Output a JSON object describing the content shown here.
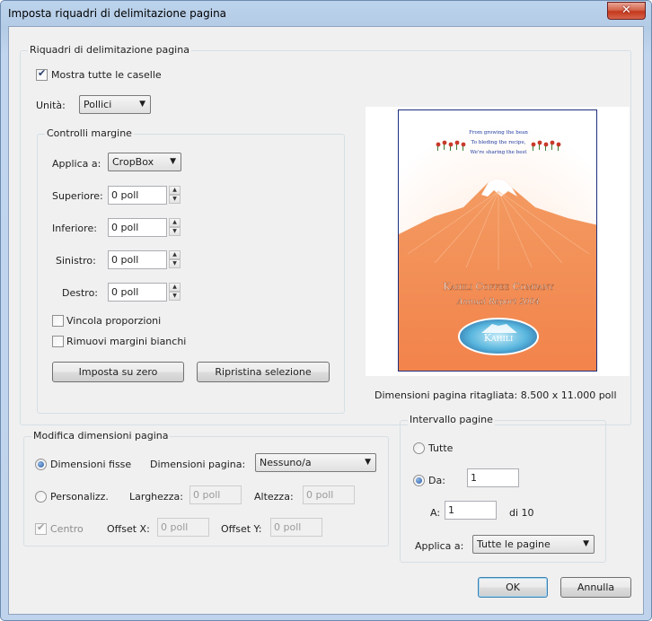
{
  "title": "Imposta riquadri di delimitazione pagina",
  "close_label": "✕",
  "boxes": {
    "title": "Riquadri di delimitazione pagina",
    "show_all": {
      "label": "Mostra tutte le caselle",
      "checked": true
    },
    "units_label": "Unità:",
    "units_value": "Pollici",
    "margins": {
      "title": "Controlli margine",
      "apply_label": "Applica a:",
      "apply_value": "CropBox",
      "top_label": "Superiore:",
      "top_value": "0 poll",
      "bottom_label": "Inferiore:",
      "bottom_value": "0 poll",
      "left_label": "Sinistro:",
      "left_value": "0 poll",
      "right_label": "Destro:",
      "right_value": "0 poll",
      "constrain_label": "Vincola proporzioni",
      "remove_white_label": "Rimuovi margini bianchi",
      "set_zero_label": "Imposta su zero",
      "revert_label": "Ripristina selezione"
    },
    "preview_caption": "Dimensioni pagina ritagliata: 8.500 x 11.000 poll",
    "page_text": {
      "line1": "From growing the bean",
      "line2": "To bleding the recipe,",
      "line3": "We're sharing the best",
      "company": "Kahili Coffee Company",
      "report": "Annual Report 2004",
      "logo": "Kahili"
    }
  },
  "resize": {
    "title": "Modifica dimensioni pagina",
    "fixed_label": "Dimensioni fisse",
    "page_size_label": "Dimensioni pagina:",
    "page_size_value": "Nessuno/a",
    "custom_label": "Personalizz.",
    "width_label": "Larghezza:",
    "width_value": "0 poll",
    "height_label": "Altezza:",
    "height_value": "0 poll",
    "center_label": "Centro",
    "offset_x_label": "Offset X:",
    "offset_x_value": "0 poll",
    "offset_y_label": "Offset Y:",
    "offset_y_value": "0 poll"
  },
  "range": {
    "title": "Intervallo pagine",
    "all_label": "Tutte",
    "from_label": "Da:",
    "from_value": "1",
    "to_label": "A:",
    "to_value": "1",
    "of_label": "di 10",
    "apply_label": "Applica a:",
    "apply_value": "Tutte le pagine"
  },
  "ok_label": "OK",
  "cancel_label": "Annulla",
  "colors": {
    "mountain_orange": "#f28a52",
    "sky_blue": "#1f3aa0",
    "logo_teal": "#3d9fcf"
  }
}
